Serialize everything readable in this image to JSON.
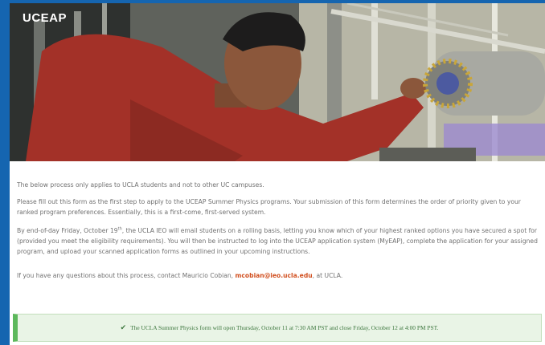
{
  "brand": {
    "name": "UCEAP"
  },
  "hero": {
    "alt": "researcher-adjusting-physics-apparatus"
  },
  "content": {
    "p1": "The below process only applies to UCLA students and not to other UC campuses.",
    "p2": "Please fill out this form as the first step to apply to the UCEAP Summer Physics programs. Your submission of this form determines the order of priority given to your ranked program preferences. Essentially, this is a first-come, first-served system.",
    "p3_before_sup": "By end-of-day Friday, October 19",
    "p3_sup": "th",
    "p3_after_sup": ", the UCLA IEO will email students on a rolling basis, letting you know which of your highest ranked options you have secured a spot for (provided you meet the eligibility requirements). You will then be instructed to log into the UCEAP application system (MyEAP), complete the application for your assigned program, and upload your scanned application forms as outlined in your upcoming instructions.",
    "p4_before_link": "If you have any questions about this process, contact Mauricio Cobian, ",
    "p4_email": "mcobian@ieo.ucla.edu",
    "p4_after_link": ", at UCLA."
  },
  "notice": {
    "icon": "check-icon",
    "text": "The UCLA Summer Physics form will open Thursday, October 11 at 7:30 AM PST and close Friday, October 12 at 4:00 PM PST."
  },
  "colors": {
    "frame": "#1565b0",
    "link": "#d14f1f",
    "notice_bg": "#e9f4e6",
    "notice_border": "#5cb85c",
    "notice_text": "#3c763d"
  }
}
